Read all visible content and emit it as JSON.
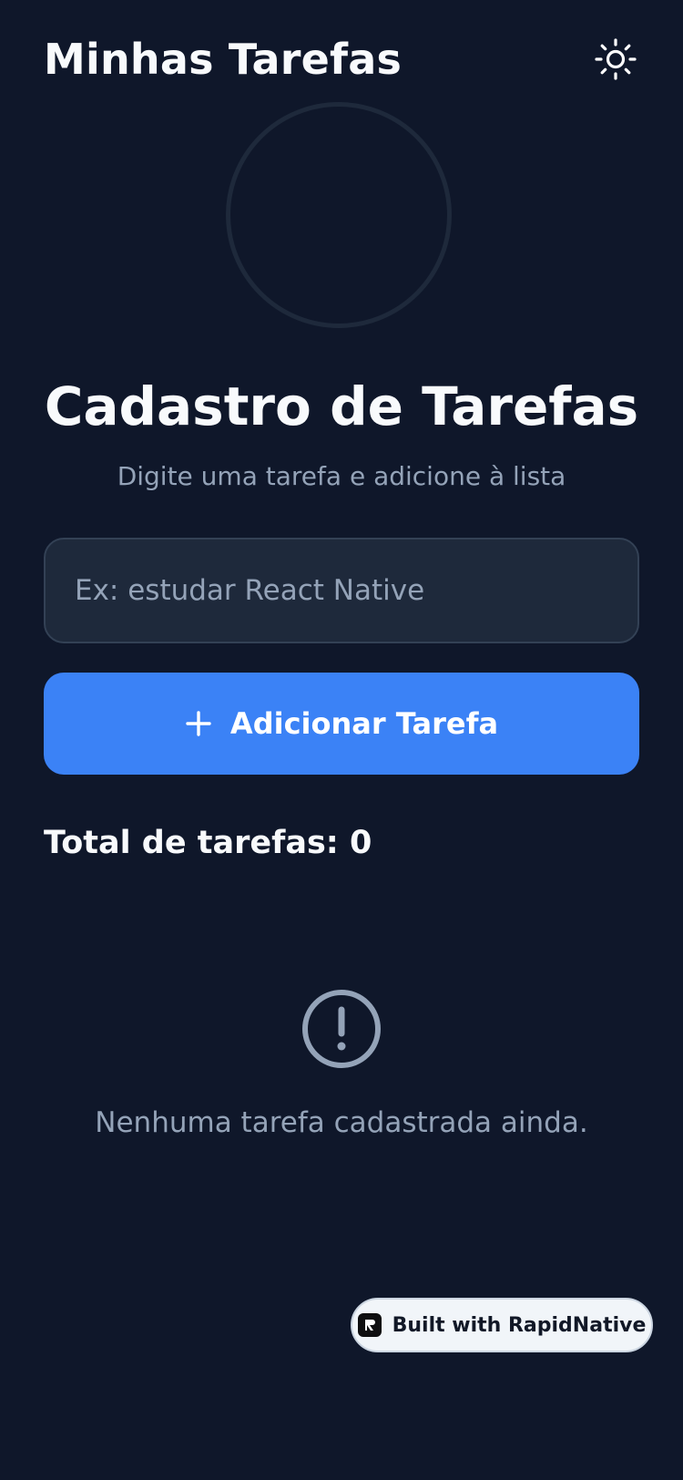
{
  "header": {
    "title": "Minhas Tarefas",
    "theme_icon": "sun-icon"
  },
  "hero": {
    "title": "Cadastro de Tarefas",
    "subtitle": "Digite uma tarefa e adicione à lista"
  },
  "form": {
    "input_placeholder": "Ex: estudar React Native",
    "input_value": "",
    "add_button_label": "Adicionar Tarefa",
    "add_button_icon": "plus-icon"
  },
  "summary": {
    "total_label": "Total de tarefas: 0",
    "total_count": 0
  },
  "empty_state": {
    "icon": "exclamation-circle-icon",
    "message": "Nenhuma tarefa cadastrada ainda."
  },
  "badge": {
    "label": "Built with RapidNative",
    "logo": "rapidnative-logo"
  },
  "colors": {
    "background": "#0f172a",
    "surface": "#1e293b",
    "accent": "#3b82f6",
    "text_primary": "#f8fafc",
    "text_muted": "#94a3b8"
  }
}
